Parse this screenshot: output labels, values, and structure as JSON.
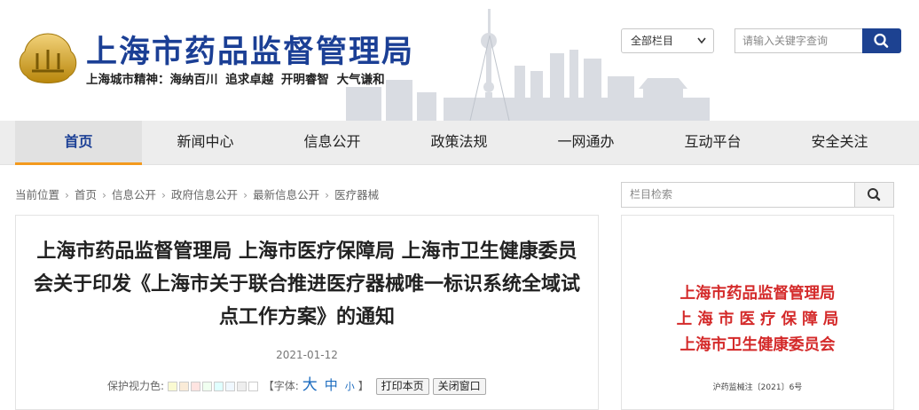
{
  "header": {
    "site_title": "上海市药品监督管理局",
    "motto": "上海城市精神：海纳百川  追求卓越  开明睿智  大气谦和",
    "scope_select": "全部栏目",
    "search_placeholder": "请输入关键字查询",
    "search_icon": "search-icon",
    "logo_icon": "sh-logo"
  },
  "nav": {
    "items": [
      {
        "label": "首页",
        "active": true
      },
      {
        "label": "新闻中心"
      },
      {
        "label": "信息公开"
      },
      {
        "label": "政策法规"
      },
      {
        "label": "一网通办"
      },
      {
        "label": "互动平台"
      },
      {
        "label": "安全关注"
      }
    ]
  },
  "breadcrumb": {
    "prefix": "当前位置",
    "items": [
      "首页",
      "信息公开",
      "政府信息公开",
      "最新信息公开",
      "医疗器械"
    ]
  },
  "article": {
    "title": "上海市药品监督管理局 上海市医疗保障局 上海市卫生健康委员会关于印发《上海市关于联合推进医疗器械唯一标识系统全域试点工作方案》的通知",
    "date": "2021-01-12",
    "protect_label": "保护视力色:",
    "swatches": [
      "#fafad2",
      "#faebd7",
      "#ffe4e1",
      "#f0fff0",
      "#e0ffff",
      "#f0f8ff",
      "#eeeeee",
      "#ffffff"
    ],
    "font_label_open": "【字体:",
    "font_big": "大",
    "font_mid": "中",
    "font_small": "小",
    "font_label_close": "】",
    "print_label": "打印本页",
    "close_label": "关闭窗口"
  },
  "sidebar": {
    "search_placeholder": "栏目检索",
    "doc_lines": [
      "上海市药品监督管理局",
      "上 海 市 医 疗 保 障 局",
      "上海市卫生健康委员会"
    ],
    "doc_number": "沪药监械注〔2021〕6号"
  },
  "colors": {
    "brand": "#1b3f95",
    "accent": "#f39a1e",
    "doc_red": "#d42a2a"
  }
}
